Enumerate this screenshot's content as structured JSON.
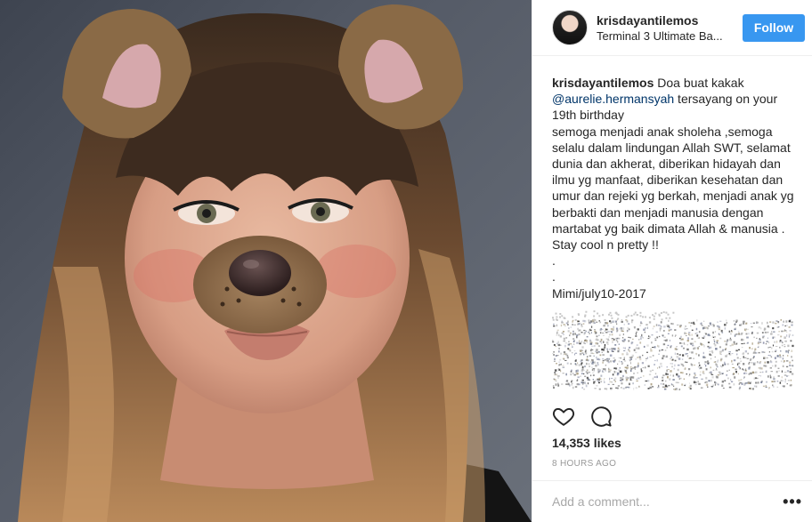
{
  "post": {
    "username": "krisdayantilemos",
    "location": "Terminal 3 Ultimate Ba...",
    "follow_label": "Follow",
    "caption": {
      "username": "krisdayantilemos",
      "text_1": " Doa buat kakak",
      "mention": "@aurelie.hermansyah",
      "text_2": " tersayang on your 19th birthday\nsemoga menjadi anak sholeha ,semoga selalu dalam lindungan Allah SWT, selamat dunia dan akherat, diberikan hidayah dan ilmu yg manfaat, diberikan kesehatan dan umur dan rejeki yg berkah, menjadi anak yg berbakti dan menjadi manusia dengan martabat yg baik dimata Allah & manusia . Stay cool n pretty !!\n.\n.\nMimi/july10-2017"
    },
    "likes": "14,353 likes",
    "time": "8 HOURS AGO",
    "comment_placeholder": "Add a comment...",
    "more_label": "•••"
  },
  "icons": {
    "like": "heart-icon",
    "comment": "comment-icon",
    "more": "more-options-icon"
  },
  "colors": {
    "follow_button": "#3897f0",
    "mention": "#003569",
    "border": "#efefef",
    "muted": "#999999"
  }
}
